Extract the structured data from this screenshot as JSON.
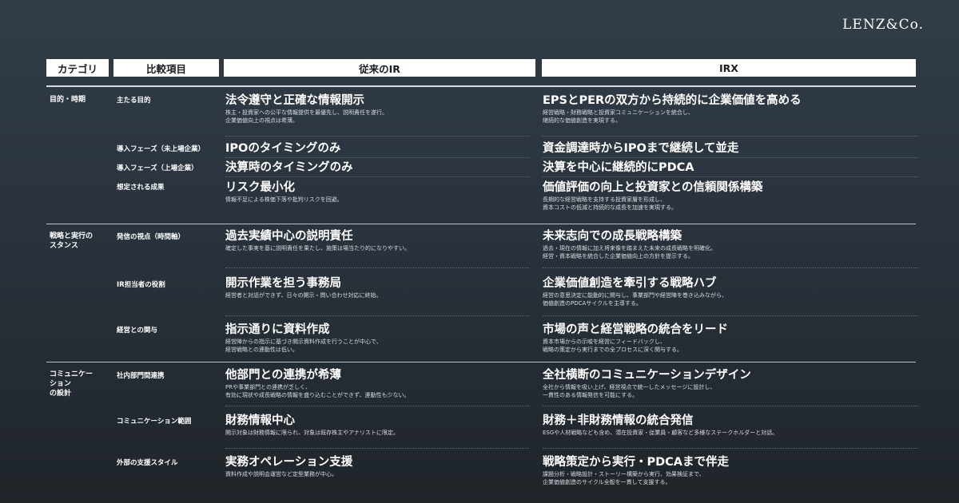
{
  "brand": "LENZ&Co.",
  "headers": {
    "category": "カテゴリ",
    "item": "比較項目",
    "traditional": "従来のIR",
    "irx": "IRX"
  },
  "categories": [
    "目的・時期",
    "戦略と実行の\nスタンス",
    "コミュニケー\nション\nの設計"
  ],
  "rows": [
    {
      "item": "主たる目的",
      "trad_main": "法令遵守と正確な情報開示",
      "trad_sub": [
        "株主・投資家への公平な情報提供を最優先し、説明責任を遂行。",
        "企業価値向上の視点は希薄。"
      ],
      "irx_main": "EPSとPERの双方から持続的に企業価値を高める",
      "irx_sub": [
        "経営戦略・財務戦略と投資家コミュニケーションを統合し、",
        "継続的な価値創造を実現する。"
      ]
    },
    {
      "item": "導入フェーズ（未上場企業）",
      "trad_main": "IPOのタイミングのみ",
      "trad_sub": [],
      "irx_main": "資金調達時からIPOまで継続して並走",
      "irx_sub": []
    },
    {
      "item": "導入フェーズ（上場企業）",
      "trad_main": "決算時のタイミングのみ",
      "trad_sub": [],
      "irx_main": "決算を中心に継続的にPDCA",
      "irx_sub": []
    },
    {
      "item": "想定される成果",
      "trad_main": "リスク最小化",
      "trad_sub": [
        "情報不足による株価下落や批判リスクを回避。"
      ],
      "irx_main": "価値評価の向上と投資家との信頼関係構築",
      "irx_sub": [
        "長期的な経営戦略を支持する投資家層を形成し、",
        "資本コストの低減と持続的な成長を加速を実現する。"
      ]
    },
    {
      "item": "発信の視点（時間軸）",
      "trad_main": "過去実績中心の説明責任",
      "trad_sub": [
        "確定した事実を基に説明責任を果たし、施策は場当たり的になりやすい。"
      ],
      "irx_main": "未来志向での成長戦略構築",
      "irx_sub": [
        "過去・現在の情報に加え将来像を踏まえた未来の成長戦略を明確化。",
        "経営・資本戦略を統合した企業価値向上の方針を提示する。"
      ]
    },
    {
      "item": "IR担当者の役割",
      "trad_main": "開示作業を担う事務局",
      "trad_sub": [
        "経営者と対話ができず、日々の開示・問い合わせ対応に終始。"
      ],
      "irx_main": "企業価値創造を牽引する戦略ハブ",
      "irx_sub": [
        "経営の意思決定に能動的に関与し、事業部門や経営陣を巻き込みながら、",
        "価値創造のPDCAサイクルを主導する。"
      ]
    },
    {
      "item": "経営との関与",
      "trad_main": "指示通りに資料作成",
      "trad_sub": [
        "経営陣からの指示に基づき開示資料作成を行うことが中心で、",
        "経営戦略との連動性は低い。"
      ],
      "irx_main": "市場の声と経営戦略の統合をリード",
      "irx_sub": [
        "資本市場からの示唆を経営にフィードバックし、",
        "戦略の策定から実行までの全プロセスに深く関与する。"
      ]
    },
    {
      "item": "社内部門間連携",
      "trad_main": "他部門との連携が希薄",
      "trad_sub": [
        "PRや事業部門との連携が乏しく、",
        "有効に現状や成長戦略の情報を盛り込むことができず、連動性も少ない。"
      ],
      "irx_main": "全社横断のコミュニケーションデザイン",
      "irx_sub": [
        "全社から情報を吸い上げ、経営視点で統一したメッセージに設計し、",
        "一貫性のある情報発信を可能にする。"
      ]
    },
    {
      "item": "コミュニケーション範囲",
      "trad_main": "財務情報中心",
      "trad_sub": [
        "開示対象は財務情報に限られ、対象は既存株主やアナリストに限定。"
      ],
      "irx_main": "財務＋非財務情報の統合発信",
      "irx_sub": [
        "ESGや人材戦略なども含め、潜在投資家・従業員・顧客など多様なステークホルダーと対話。"
      ]
    },
    {
      "item": "外部の支援スタイル",
      "trad_main": "実務オペレーション支援",
      "trad_sub": [
        "資料作成や説明会運営など定型業務が中心。"
      ],
      "irx_main": "戦略策定から実行・PDCAまで伴走",
      "irx_sub": [
        "課題分析・戦略設計・ストーリー構築から実行、効果検証まで、",
        "企業価値創造のサイクル全般を一貫して支援する。"
      ]
    }
  ]
}
